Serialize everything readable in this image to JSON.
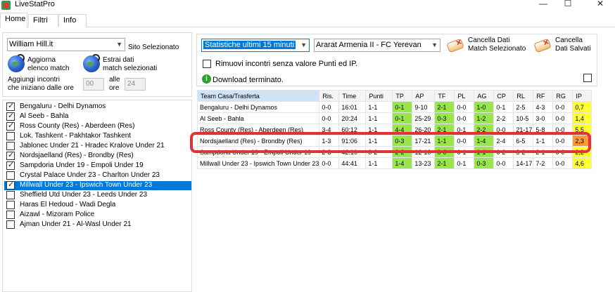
{
  "window": {
    "title": "LiveStatPro",
    "minimize": "—",
    "maximize": "☐",
    "close": "✕"
  },
  "tabs": [
    {
      "label": "Home"
    },
    {
      "label": "Filtri"
    },
    {
      "label": "Info"
    }
  ],
  "site": {
    "selected": "William Hill.it",
    "label": "Sito Selezionato"
  },
  "actions": {
    "refresh": [
      "Aggiorna",
      "elenco match"
    ],
    "extract": [
      "Estrai dati",
      "match selezionati"
    ]
  },
  "add_matches": {
    "label_line1": "Aggiungi incontri",
    "label_line2": "che iniziano dalle ore",
    "from_value": "00",
    "to_label_line1": "alle",
    "to_label_line2": "ore",
    "to_value": "24"
  },
  "matches": [
    {
      "text": "Bengaluru  - Delhi Dynamos",
      "checked": true,
      "selected": false
    },
    {
      "text": "Al Seeb  - Bahla",
      "checked": true,
      "selected": false
    },
    {
      "text": "Ross County (Res)  - Aberdeen (Res)",
      "checked": true,
      "selected": false
    },
    {
      "text": "Lok. Tashkent  - Pakhtakor Tashkent",
      "checked": false,
      "selected": false
    },
    {
      "text": "Jablonec Under 21  - Hradec Kralove Under 21",
      "checked": false,
      "selected": false
    },
    {
      "text": "Nordsjaelland (Res)  - Brondby (Res)",
      "checked": true,
      "selected": false
    },
    {
      "text": "Sampdoria Under 19  - Empoli Under 19",
      "checked": true,
      "selected": false
    },
    {
      "text": "Crystal Palace Under 23  - Charlton Under 23",
      "checked": false,
      "selected": false
    },
    {
      "text": "Millwall Under 23  - Ipswich Town Under 23",
      "checked": true,
      "selected": true
    },
    {
      "text": "Sheffield Utd Under 23  - Leeds Under 23",
      "checked": false,
      "selected": false
    },
    {
      "text": "Haras El Hedoud  - Wadi Degla",
      "checked": false,
      "selected": false
    },
    {
      "text": "Aizawl  - Mizoram Police",
      "checked": false,
      "selected": false
    },
    {
      "text": "Ajman Under 21  - Al-Wasl Under 21",
      "checked": false,
      "selected": false
    }
  ],
  "stats_period": "Statistiche ultimi 15 minuti",
  "match_selected": "Ararat Armenia II - FC Yerevan",
  "clear_match": [
    "Cancella Dati",
    "Match Selezionato"
  ],
  "clear_saved": [
    "Cancella",
    "Dati Salvati"
  ],
  "remove_label": "Rimuovi incontri senza valore Punti ed IP.",
  "status": "Download terminato.",
  "table": {
    "headers": [
      "Team Casa/Trasferta",
      "Ris.",
      "Time",
      "Punti",
      "TP",
      "AP",
      "TF",
      "PL",
      "AG",
      "CP",
      "RL",
      "RF",
      "RG",
      "IP"
    ],
    "rows": [
      {
        "cells": [
          "Bengaluru - Delhi Dynamos",
          "0-0",
          "16:01",
          "1-1",
          "0-1",
          "9-10",
          "2-1",
          "0-0",
          "1-0",
          "0-1",
          "2-5",
          "4-3",
          "0-0",
          "0,7"
        ],
        "colors": [
          "",
          "",
          "",
          "",
          "g",
          "",
          "g",
          "",
          "g",
          "",
          "",
          "",
          "",
          "y"
        ]
      },
      {
        "cells": [
          "Al Seeb - Bahla",
          "0-0",
          "20:24",
          "1-1",
          "0-1",
          "25-29",
          "0-3",
          "0-0",
          "1-2",
          "2-2",
          "10-5",
          "3-0",
          "0-0",
          "1,4"
        ],
        "colors": [
          "",
          "",
          "",
          "",
          "g",
          "",
          "g",
          "",
          "g",
          "",
          "",
          "",
          "",
          "y"
        ]
      },
      {
        "cells": [
          "Ross County (Res) - Aberdeen (Res)",
          "3-4",
          "60:12",
          "1-1",
          "4-4",
          "26-20",
          "2-1",
          "0-1",
          "2-2",
          "0-0",
          "21-17",
          "5-8",
          "0-0",
          "5,5"
        ],
        "colors": [
          "",
          "",
          "",
          "",
          "g",
          "",
          "g",
          "",
          "g",
          "",
          "",
          "",
          "",
          "y"
        ]
      },
      {
        "cells": [
          "Nordsjaelland (Res) - Brondby (Res)",
          "1-3",
          "91:06",
          "1-1",
          "0-3",
          "17-21",
          "1-1",
          "0-0",
          "1-4",
          "2-4",
          "6-5",
          "1-1",
          "0-0",
          "2,3"
        ],
        "colors": [
          "",
          "",
          "",
          "",
          "g",
          "",
          "g",
          "",
          "g",
          "",
          "",
          "",
          "",
          "o"
        ]
      },
      {
        "cells": [
          "Sampdoria Under 19 - Empoli Under 19",
          "2-3",
          "42:10",
          "0-2",
          "2-2",
          "12-10",
          "0-0",
          "0-1",
          "1-1",
          "0-2",
          "3-2",
          "2-1",
          "0-0",
          "2,2"
        ],
        "colors": [
          "",
          "",
          "",
          "",
          "g",
          "",
          "g",
          "",
          "g",
          "",
          "",
          "",
          "",
          "y"
        ]
      },
      {
        "cells": [
          "Millwall Under 23 - Ipswich Town Under 23",
          "0-0",
          "44:41",
          "1-1",
          "1-4",
          "13-23",
          "2-1",
          "0-1",
          "0-3",
          "0-0",
          "14-17",
          "7-2",
          "0-0",
          "4,6"
        ],
        "colors": [
          "",
          "",
          "",
          "",
          "g",
          "",
          "g",
          "",
          "g",
          "",
          "",
          "",
          "",
          "y"
        ]
      }
    ]
  }
}
